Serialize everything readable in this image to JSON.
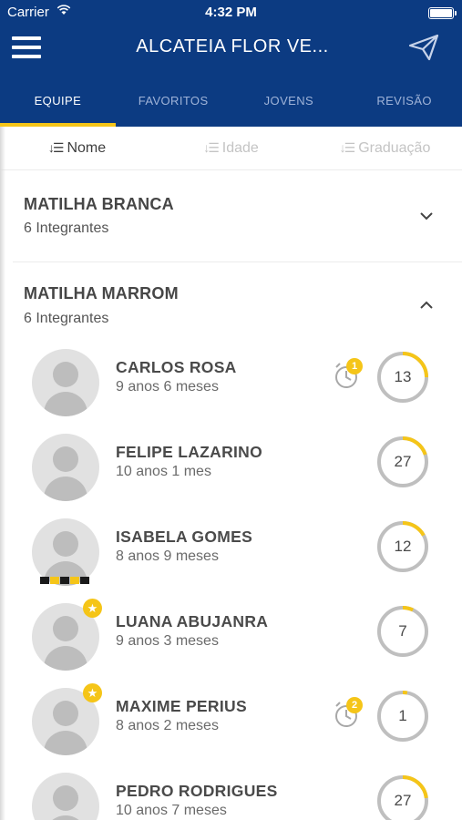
{
  "status": {
    "carrier": "Carrier",
    "time": "4:32 PM"
  },
  "nav": {
    "title": "ALCATEIA FLOR VE..."
  },
  "tabs": [
    "EQUIPE",
    "FAVORITOS",
    "JOVENS",
    "REVISÃO"
  ],
  "sort": [
    "Nome",
    "Idade",
    "Graduação"
  ],
  "groups": [
    {
      "title": "MATILHA BRANCA",
      "subtitle": "6 Integrantes",
      "expanded": false
    },
    {
      "title": "MATILHA MARROM",
      "subtitle": "6 Integrantes",
      "expanded": true
    }
  ],
  "members": [
    {
      "name": "CARLOS ROSA",
      "age": "9 anos 6 meses",
      "count": "13",
      "progress": 0.25,
      "alarm_badge": "1",
      "starred": false,
      "scarf": false
    },
    {
      "name": "FELIPE LAZARINO",
      "age": "10 anos 1 mes",
      "count": "27",
      "progress": 0.2,
      "alarm_badge": null,
      "starred": false,
      "scarf": false
    },
    {
      "name": "ISABELA GOMES",
      "age": "8 anos 9 meses",
      "count": "12",
      "progress": 0.17,
      "alarm_badge": null,
      "starred": false,
      "scarf": true
    },
    {
      "name": "LUANA ABUJANRA",
      "age": "9 anos 3 meses",
      "count": "7",
      "progress": 0.07,
      "alarm_badge": null,
      "starred": true,
      "scarf": false
    },
    {
      "name": "MAXIME PERIUS",
      "age": "8 anos 2 meses",
      "count": "1",
      "progress": 0.03,
      "alarm_badge": "2",
      "starred": true,
      "scarf": false
    },
    {
      "name": "PEDRO RODRIGUES",
      "age": "10 anos 7 meses",
      "count": "27",
      "progress": 0.23,
      "alarm_badge": null,
      "starred": false,
      "scarf": false
    }
  ],
  "colors": {
    "primary": "#0c3b82",
    "accent": "#f5c518",
    "ring_track": "#bfbfbf"
  },
  "icons": {
    "menu": "hamburger-icon",
    "send": "paper-plane-icon",
    "sort": "sort-icon",
    "collapse": "chevron-down-icon",
    "expand": "chevron-up-icon",
    "alarm": "alarm-clock-icon",
    "star": "star-icon"
  }
}
